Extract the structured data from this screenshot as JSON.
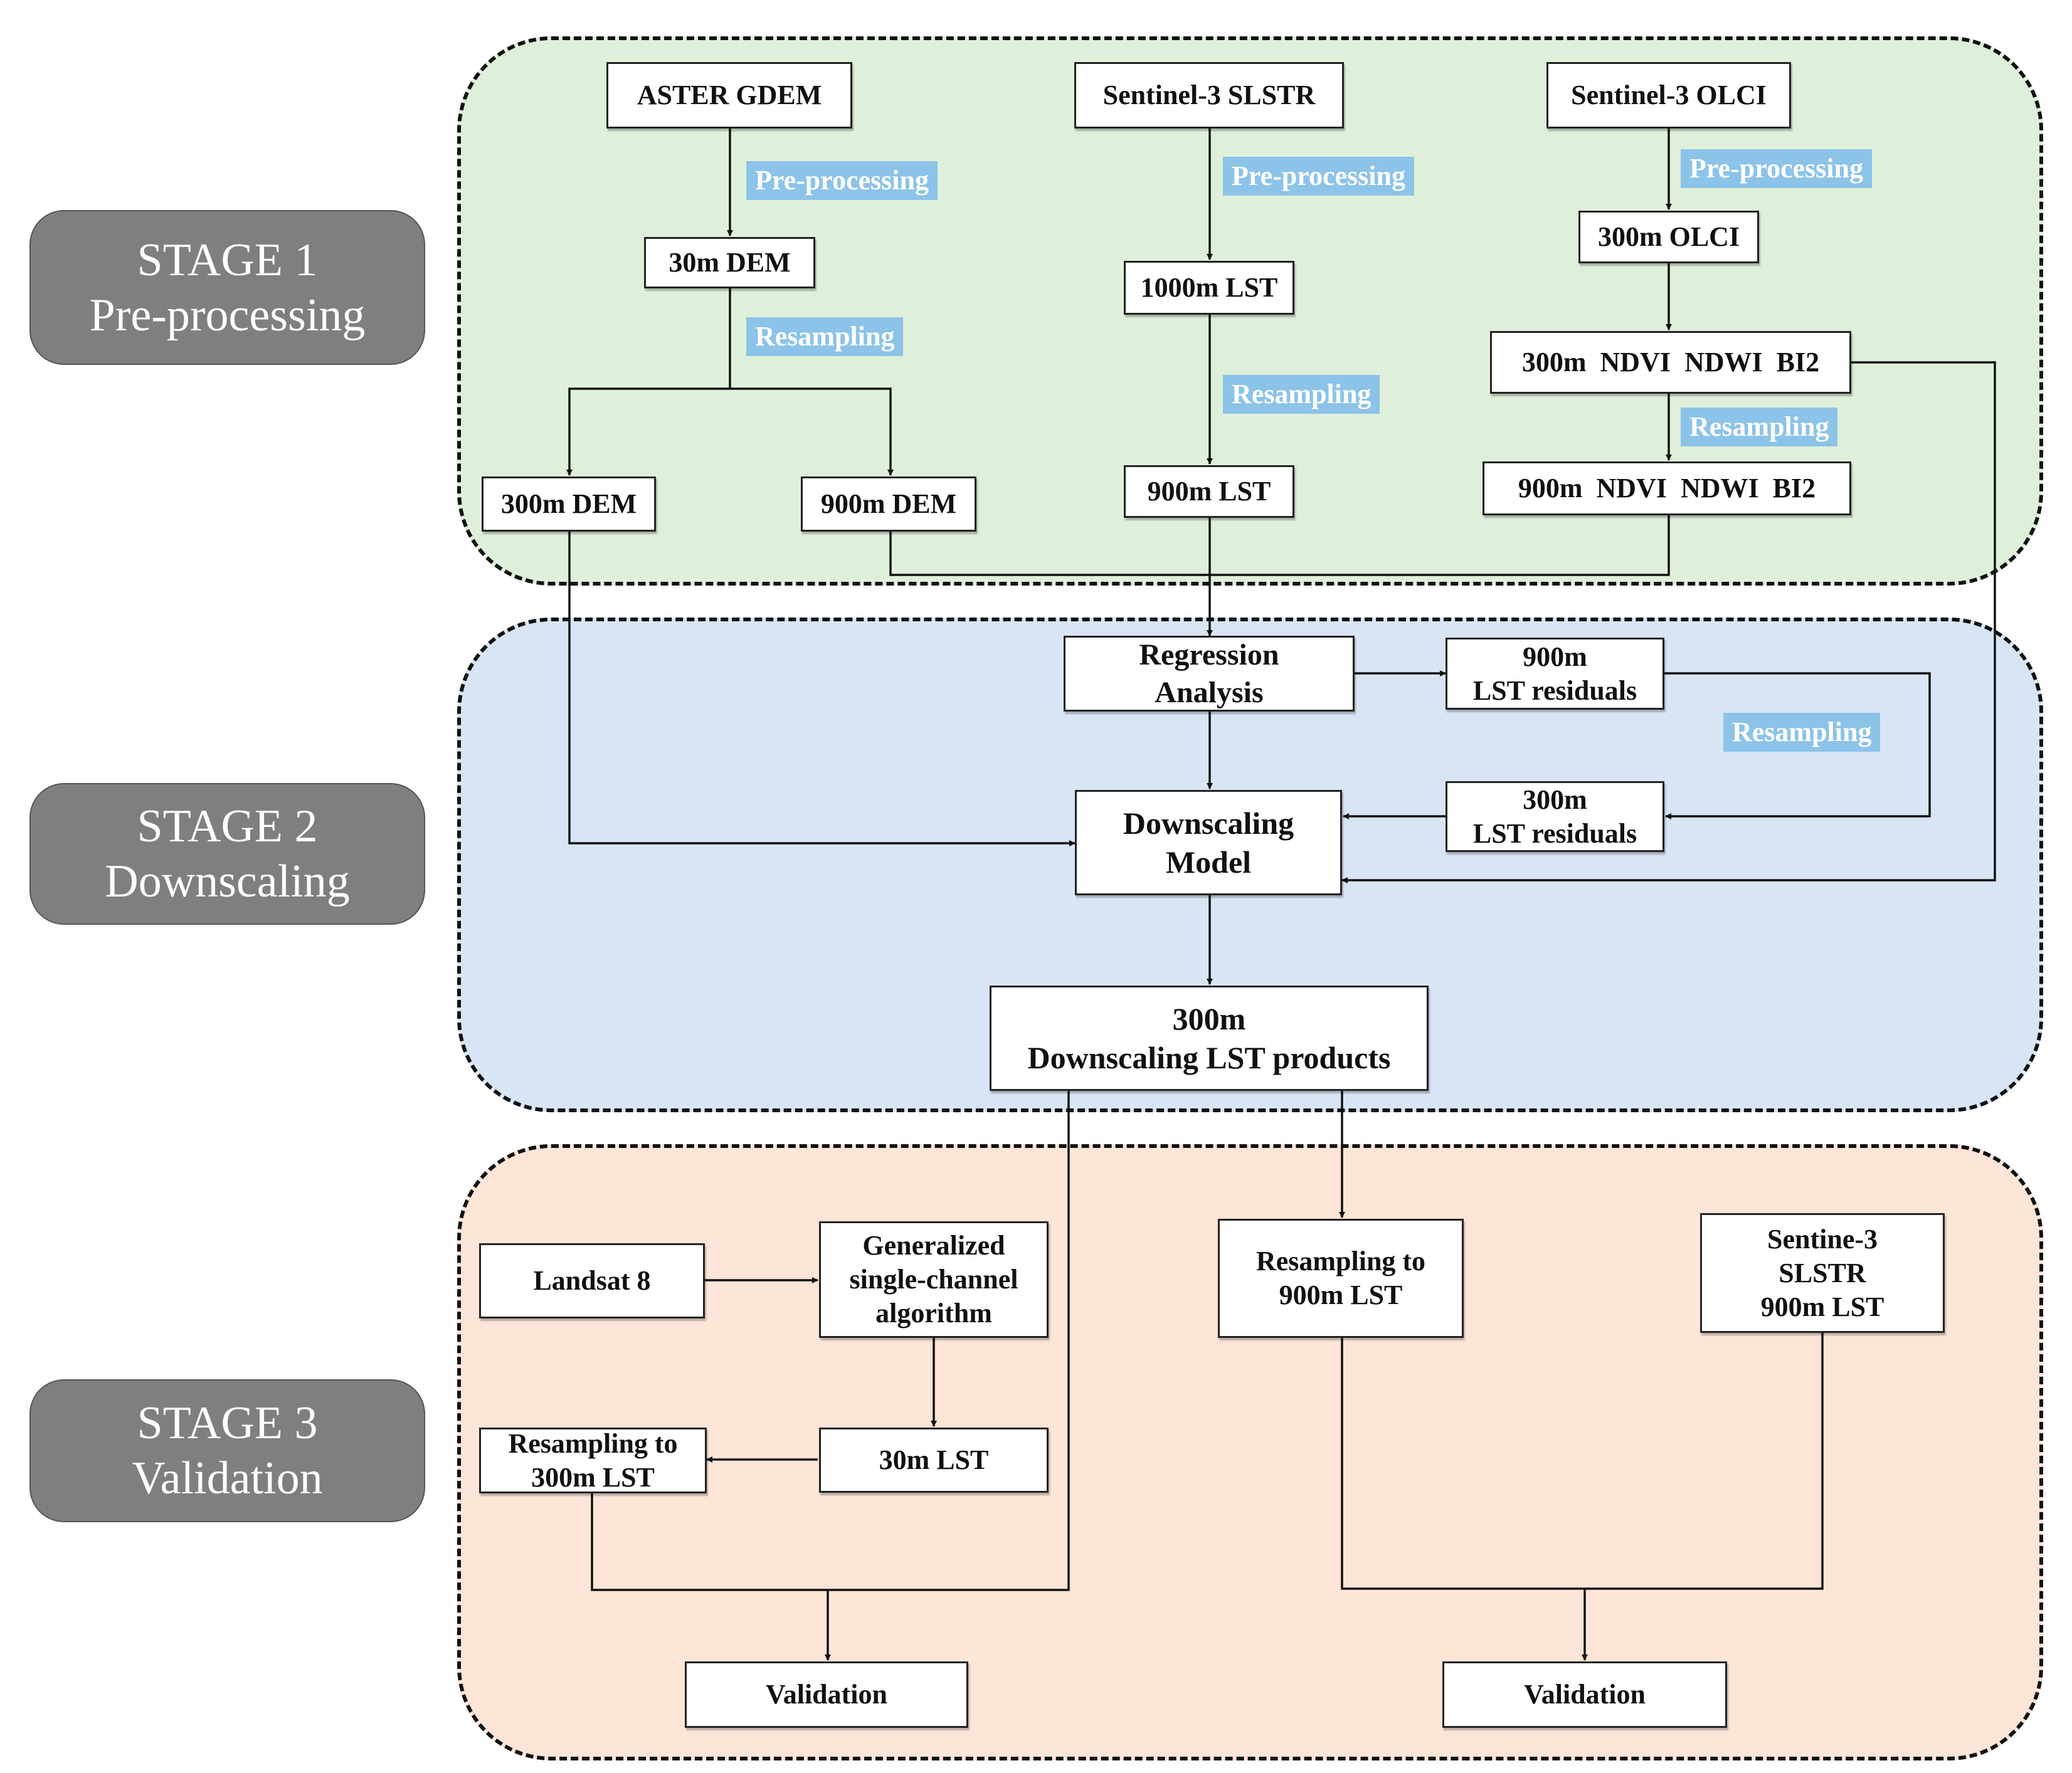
{
  "stages": [
    {
      "title": "STAGE 1",
      "subtitle": "Pre-processing",
      "color": "#dff0da"
    },
    {
      "title": "STAGE 2",
      "subtitle": "Downscaling",
      "color": "#d8e5f4"
    },
    {
      "title": "STAGE 3",
      "subtitle": "Validation",
      "color": "#fde5d8"
    }
  ],
  "stage1": {
    "aster": "ASTER GDEM",
    "slstr": "Sentinel-3 SLSTR",
    "olci": "Sentinel-3 OLCI",
    "dem30": "30m DEM",
    "lst1000": "1000m LST",
    "olci300": "300m OLCI",
    "ndvi300": "300m  NDVI  NDWI  BI2",
    "ndvi900": "900m  NDVI  NDWI  BI2",
    "dem300": "300m DEM",
    "dem900": "900m DEM",
    "lst900": "900m LST",
    "tags": {
      "preproc_a": "Pre-processing",
      "preproc_b": "Pre-processing",
      "preproc_c": "Pre-processing",
      "resamp_a": "Resampling",
      "resamp_b": "Resampling",
      "resamp_c": "Resampling"
    }
  },
  "stage2": {
    "regression": [
      "Regression",
      "Analysis"
    ],
    "res900": [
      "900m",
      "LST residuals"
    ],
    "res300": [
      "300m",
      "LST residuals"
    ],
    "model": [
      "Downscaling",
      "Model"
    ],
    "product": [
      "300m",
      "Downscaling LST products"
    ],
    "tag_resamp": "Resampling"
  },
  "stage3": {
    "landsat": "Landsat 8",
    "gsc": [
      "Generalized",
      "single-channel",
      "algorithm"
    ],
    "lst30": "30m LST",
    "resamp300": [
      "Resampling to",
      "300m LST"
    ],
    "resamp900": [
      "Resampling to",
      "900m LST"
    ],
    "sentinel": [
      "Sentine-3",
      "SLSTR",
      "900m LST"
    ],
    "validation_left": "Validation",
    "validation_right": "Validation"
  },
  "colors": {
    "tag_bg": "#8cc3e8",
    "stage_label_bg": "#7f7f7f"
  }
}
